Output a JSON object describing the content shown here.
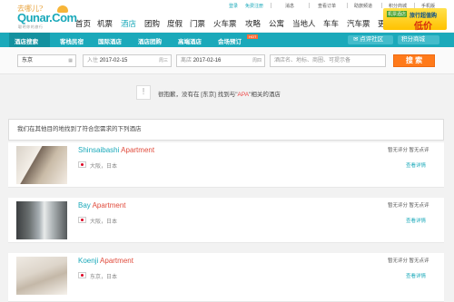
{
  "header": {
    "logo_tagline": "去哪儿?",
    "logo_name": "Qunar.Com",
    "logo_sub": "聪明你的旅行",
    "util_links": [
      "登录",
      "免费注册",
      "消息",
      "查看订单",
      "助旅频道",
      "积分商城",
      "手机版"
    ],
    "nav": [
      "首页",
      "机票",
      "酒店",
      "团购",
      "度假",
      "门票",
      "火车票",
      "攻略",
      "公寓",
      "当地人",
      "车车",
      "汽车票",
      "更多"
    ],
    "active_nav": "酒店",
    "promo_badge": "机票酒店",
    "promo_title": "旅行超值购",
    "promo_price": "低价"
  },
  "subnav": {
    "items": [
      "酒店搜索",
      "客栈民宿",
      "国际酒店",
      "酒店团购",
      "高端酒店",
      "会场预订"
    ],
    "active": "酒店搜索",
    "hot_badge": "HOT",
    "community_button": "点评社区",
    "points_button": "积分商城"
  },
  "search": {
    "city": "东京",
    "checkin_label": "入住",
    "checkin": "2017-02-15",
    "checkin_weekday": "周三",
    "checkout_label": "离店",
    "checkout": "2017-02-16",
    "checkout_weekday": "周四",
    "keyword_placeholder": "酒店名、地标、商圈、可提示备",
    "button": "搜 索"
  },
  "notice": {
    "icon": "!",
    "prefix": "很抱歉，没有在 [东京] 找到与\"",
    "keyword": "APA",
    "suffix": "\"相关的酒店"
  },
  "results_header": "我们在其他目的地找到了符合您需求的下列酒店",
  "hotels": [
    {
      "name": "Shinsaibashi",
      "type": "Apartment",
      "location": "大阪，日本",
      "rating": "暂无评分 暂无点评",
      "detail": "查看详情"
    },
    {
      "name": "Bay",
      "type": "Apartment",
      "location": "大阪，日本",
      "rating": "暂无评分 暂无点评",
      "detail": "查看详情"
    },
    {
      "name": "Koenji",
      "type": "Apartment",
      "location": "东京，日本",
      "rating": "暂无评分 暂无点评",
      "detail": "查看详情"
    }
  ],
  "colors": {
    "brand": "#1ba9ba",
    "accent": "#ff7a1a",
    "highlight": "#e04b3c"
  }
}
